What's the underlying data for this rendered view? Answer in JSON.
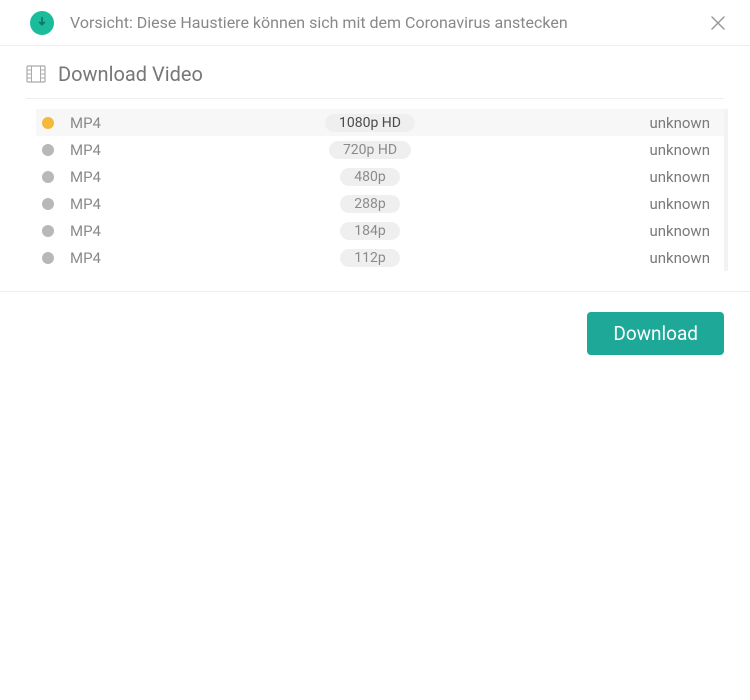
{
  "header": {
    "title": "Vorsicht: Diese Haustiere können sich mit dem Coronavirus anstecken"
  },
  "section": {
    "title": "Download Video"
  },
  "options": [
    {
      "format": "MP4",
      "quality": "1080p HD",
      "size": "unknown",
      "selected": true
    },
    {
      "format": "MP4",
      "quality": "720p HD",
      "size": "unknown",
      "selected": false
    },
    {
      "format": "MP4",
      "quality": "480p",
      "size": "unknown",
      "selected": false
    },
    {
      "format": "MP4",
      "quality": "288p",
      "size": "unknown",
      "selected": false
    },
    {
      "format": "MP4",
      "quality": "184p",
      "size": "unknown",
      "selected": false
    },
    {
      "format": "MP4",
      "quality": "112p",
      "size": "unknown",
      "selected": false
    }
  ],
  "actions": {
    "download_label": "Download"
  }
}
